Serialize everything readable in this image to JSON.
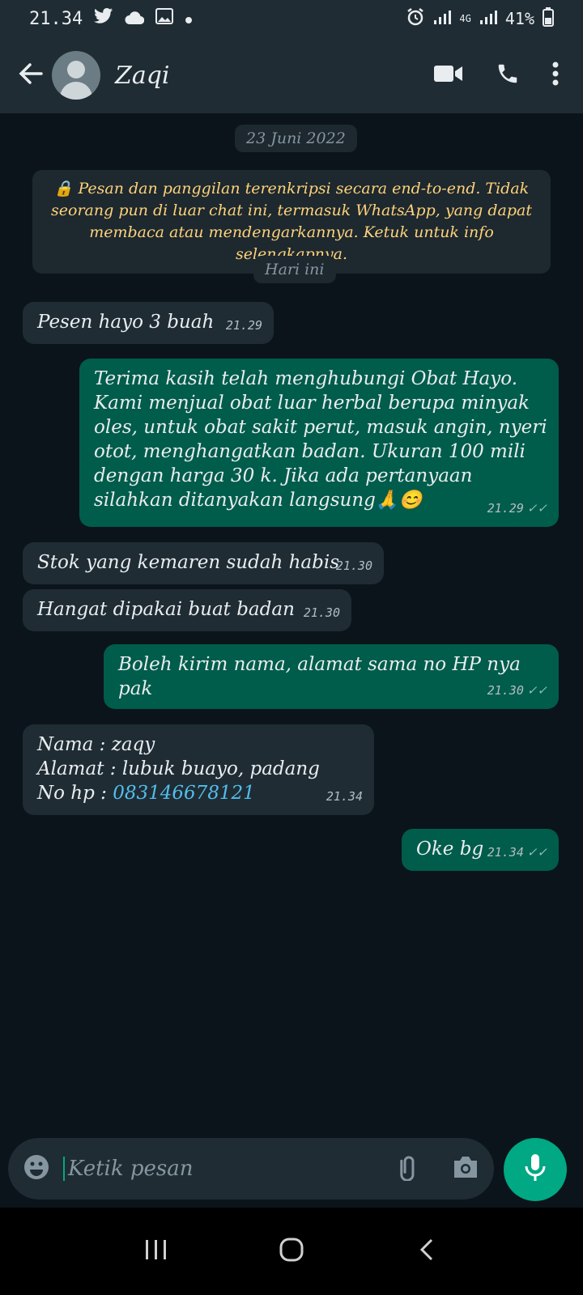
{
  "status_bar": {
    "time": "21.34",
    "battery": "41%",
    "network": "4G"
  },
  "header": {
    "contact_name": "Zaqi",
    "icons": [
      "back-arrow-icon",
      "video-call-icon",
      "voice-call-icon",
      "more-options-icon"
    ]
  },
  "chat": {
    "date_label": "23 Juni 2022",
    "encryption_notice": "🔒 Pesan dan panggilan terenkripsi secara end-to-end. Tidak seorang pun di luar chat ini, termasuk WhatsApp, yang dapat membaca atau mendengarkannya. Ketuk untuk info selengkapnya.",
    "today_label": "Hari ini",
    "messages": [
      {
        "direction": "in",
        "text": "Pesen hayo 3 buah",
        "time": "21.29"
      },
      {
        "direction": "out",
        "text": "Terima kasih telah menghubungi Obat Hayo. Kami menjual obat luar herbal berupa minyak oles, untuk obat sakit perut, masuk angin, nyeri otot, menghangatkan badan. Ukuran 100 mili dengan harga 30 k. Jika ada pertanyaan silahkan ditanyakan langsung🙏😊",
        "time": "21.29",
        "status": "read"
      },
      {
        "direction": "in",
        "text": "Stok yang kemaren sudah habis",
        "time": "21.30"
      },
      {
        "direction": "in",
        "text": "Hangat dipakai buat badan",
        "time": "21.30"
      },
      {
        "direction": "out",
        "text": "Boleh kirim nama, alamat sama no HP nya pak",
        "time": "21.30",
        "status": "read"
      },
      {
        "direction": "in",
        "line1": "Nama : zaqy",
        "line2": "Alamat : lubuk buayo, padang",
        "line3_label": "No hp : ",
        "line3_phone": "083146678121",
        "time": "21.34"
      },
      {
        "direction": "out",
        "text": "Oke bg",
        "time": "21.34",
        "status": "read"
      }
    ]
  },
  "input": {
    "placeholder": "Ketik pesan"
  },
  "colors": {
    "background": "#0b141a",
    "header": "#1f2c34",
    "incoming_bubble": "#1f2c34",
    "outgoing_bubble": "#005c4b",
    "accent": "#00a884",
    "link": "#53bdeb",
    "notice_text": "#ffd279"
  }
}
